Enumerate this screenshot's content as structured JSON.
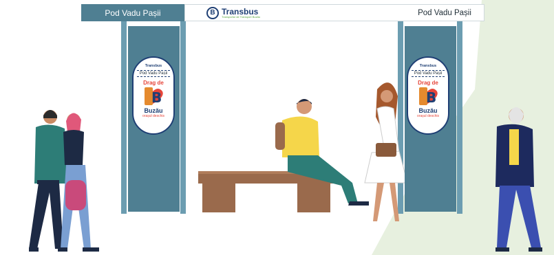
{
  "shelter": {
    "stop_name_left": "Pod Vadu Pașii",
    "stop_name_right": "Pod Vadu Pașii",
    "brand_name": "Transbus",
    "brand_subtitle": "Transportul de Transport Buzău",
    "logo_mark": "B"
  },
  "posters": [
    {
      "brand": "Transbus",
      "stop": "Pod Vadu Pașii",
      "headline": "Drag de",
      "city": "Buzău",
      "tagline": "orașul deschis"
    },
    {
      "brand": "Transbus",
      "stop": "Pod Vadu Pașii",
      "headline": "Drag de",
      "city": "Buzău",
      "tagline": "orașul deschis"
    }
  ],
  "colors": {
    "shelter_blue": "#4f7f92",
    "post_blue": "#6c9db1",
    "bench_brown": "#9a6a4c",
    "grass_green": "#e7f0df",
    "brand_navy": "#1f3f74"
  }
}
